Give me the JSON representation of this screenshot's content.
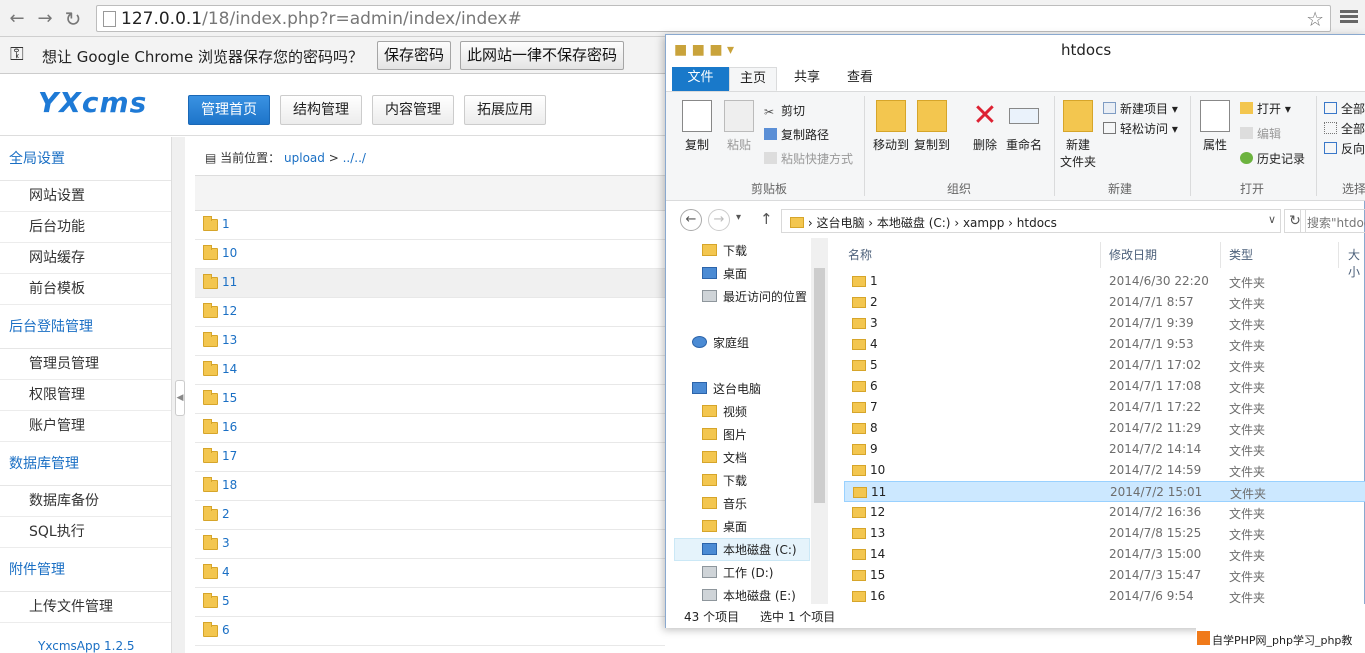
{
  "browser": {
    "url_host": "127.0.0.1",
    "url_path": "/18/index.php?r=admin/index/index#",
    "password_bar": {
      "message": "想让 Google Chrome 浏览器保存您的密码吗？",
      "save_label": "保存密码",
      "never_label": "此网站一律不保存密码"
    }
  },
  "cms": {
    "logo": "YXcms",
    "nav": [
      "管理首页",
      "结构管理",
      "内容管理",
      "拓展应用"
    ],
    "sidebar": {
      "groups": [
        {
          "title": "全局设置",
          "items": [
            "网站设置",
            "后台功能",
            "网站缓存",
            "前台模板"
          ]
        },
        {
          "title": "后台登陆管理",
          "items": [
            "管理员管理",
            "权限管理",
            "账户管理"
          ]
        },
        {
          "title": "数据库管理",
          "items": [
            "数据库备份",
            "SQL执行"
          ]
        },
        {
          "title": "附件管理",
          "items": [
            "上传文件管理"
          ]
        }
      ],
      "footer": "YxcmsApp 1.2.5"
    },
    "breadcrumb": {
      "label": "当前位置：",
      "path1": "upload",
      "sep": ">",
      "path2": "../../"
    },
    "folders": [
      "1",
      "10",
      "11",
      "12",
      "13",
      "14",
      "15",
      "16",
      "17",
      "18",
      "2",
      "3",
      "4",
      "5",
      "6"
    ]
  },
  "explorer": {
    "title": "htdocs",
    "tabs": {
      "file": "文件",
      "home": "主页",
      "share": "共享",
      "view": "查看"
    },
    "ribbon": {
      "copy": "复制",
      "paste": "粘贴",
      "cut": "剪切",
      "copy_path": "复制路径",
      "paste_shortcut": "粘贴快捷方式",
      "group_clipboard": "剪贴板",
      "move_to": "移动到",
      "copy_to": "复制到",
      "delete": "删除",
      "rename": "重命名",
      "group_organize": "组织",
      "new_folder_1": "新建",
      "new_folder_2": "文件夹",
      "new_item": "新建项目",
      "easy_access": "轻松访问",
      "group_new": "新建",
      "properties": "属性",
      "open": "打开",
      "edit": "编辑",
      "history": "历史记录",
      "group_open": "打开",
      "select_all": "全部",
      "select_none": "全部",
      "invert": "反向",
      "group_select": "选择"
    },
    "address": {
      "p1": "这台电脑",
      "p2": "本地磁盘 (C:)",
      "p3": "xampp",
      "p4": "htdocs"
    },
    "search_placeholder": "搜索\"htdoc",
    "nav": {
      "downloads": "下载",
      "desktop": "桌面",
      "recent": "最近访问的位置",
      "homegroup": "家庭组",
      "this_pc": "这台电脑",
      "videos": "视频",
      "pictures": "图片",
      "documents": "文档",
      "downloads2": "下载",
      "music": "音乐",
      "desktop2": "桌面",
      "drive_c": "本地磁盘 (C:)",
      "drive_d": "工作 (D:)",
      "drive_e": "本地磁盘 (E:)"
    },
    "columns": {
      "name": "名称",
      "modified": "修改日期",
      "type": "类型",
      "size": "大小"
    },
    "files": [
      {
        "name": "1",
        "date": "2014/6/30 22:20",
        "type": "文件夹"
      },
      {
        "name": "2",
        "date": "2014/7/1 8:57",
        "type": "文件夹"
      },
      {
        "name": "3",
        "date": "2014/7/1 9:39",
        "type": "文件夹"
      },
      {
        "name": "4",
        "date": "2014/7/1 9:53",
        "type": "文件夹"
      },
      {
        "name": "5",
        "date": "2014/7/1 17:02",
        "type": "文件夹"
      },
      {
        "name": "6",
        "date": "2014/7/1 17:08",
        "type": "文件夹"
      },
      {
        "name": "7",
        "date": "2014/7/1 17:22",
        "type": "文件夹"
      },
      {
        "name": "8",
        "date": "2014/7/2 11:29",
        "type": "文件夹"
      },
      {
        "name": "9",
        "date": "2014/7/2 14:14",
        "type": "文件夹"
      },
      {
        "name": "10",
        "date": "2014/7/2 14:59",
        "type": "文件夹"
      },
      {
        "name": "11",
        "date": "2014/7/2 15:01",
        "type": "文件夹"
      },
      {
        "name": "12",
        "date": "2014/7/2 16:36",
        "type": "文件夹"
      },
      {
        "name": "13",
        "date": "2014/7/8 15:25",
        "type": "文件夹"
      },
      {
        "name": "14",
        "date": "2014/7/3 15:00",
        "type": "文件夹"
      },
      {
        "name": "15",
        "date": "2014/7/3 15:47",
        "type": "文件夹"
      },
      {
        "name": "16",
        "date": "2014/7/6 9:54",
        "type": "文件夹"
      }
    ],
    "status": {
      "count": "43 个项目",
      "selected": "选中 1 个项目"
    }
  },
  "watermark": "自学PHP网_php学习_php教"
}
